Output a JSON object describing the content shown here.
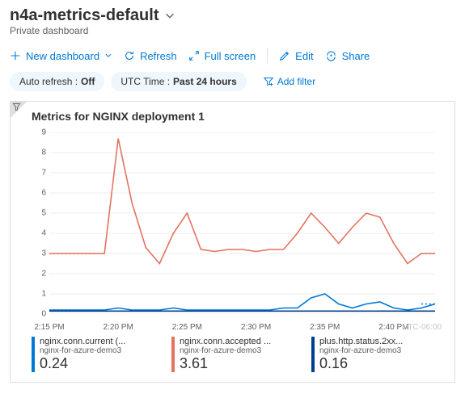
{
  "header": {
    "title": "n4a-metrics-default",
    "subtitle": "Private dashboard"
  },
  "toolbar": {
    "new_dashboard": "New dashboard",
    "refresh": "Refresh",
    "fullscreen": "Full screen",
    "edit": "Edit",
    "share": "Share"
  },
  "filters": {
    "auto_refresh_label": "Auto refresh :",
    "auto_refresh_value": "Off",
    "utc_label": "UTC Time :",
    "utc_value": "Past 24 hours",
    "add_filter": "Add filter"
  },
  "card": {
    "title": "Metrics for NGINX deployment 1",
    "tz": "UTC-06:00"
  },
  "chart_data": {
    "type": "line",
    "ylim": [
      0,
      9
    ],
    "yticks": [
      0,
      1,
      2,
      3,
      4,
      5,
      6,
      7,
      8,
      9
    ],
    "x": [
      "2:15 PM",
      "2:16",
      "2:17",
      "2:18",
      "2:19",
      "2:20 PM",
      "2:21",
      "2:22",
      "2:23",
      "2:24",
      "2:25 PM",
      "2:26",
      "2:27",
      "2:28",
      "2:29",
      "2:30 PM",
      "2:31",
      "2:32",
      "2:33",
      "2:34",
      "2:35 PM",
      "2:36",
      "2:37",
      "2:38",
      "2:39",
      "2:40 PM",
      "2:41",
      "2:42",
      "2:43"
    ],
    "x_tick_labels": [
      "2:15 PM",
      "2:20 PM",
      "2:25 PM",
      "2:30 PM",
      "2:35 PM",
      "2:40 PM"
    ],
    "x_tick_idx": [
      0,
      5,
      10,
      15,
      20,
      25
    ],
    "series": [
      {
        "name": "nginx.conn.current (...",
        "resource": "nginx-for-azure-demo3",
        "agg_value": "0.24",
        "color": "#0078d4",
        "values": [
          0.2,
          0.2,
          0.2,
          0.2,
          0.2,
          0.3,
          0.2,
          0.2,
          0.2,
          0.3,
          0.2,
          0.2,
          0.2,
          0.2,
          0.2,
          0.2,
          0.2,
          0.3,
          0.3,
          0.8,
          1.0,
          0.5,
          0.3,
          0.5,
          0.6,
          0.3,
          0.2,
          0.3,
          0.5
        ]
      },
      {
        "name": "nginx.conn.accepted ...",
        "resource": "nginx-for-azure-demo3",
        "agg_value": "3.61",
        "color": "#e3735e",
        "values": [
          3.0,
          3.0,
          3.0,
          3.0,
          3.0,
          8.7,
          5.5,
          3.3,
          2.5,
          4.0,
          5.0,
          3.2,
          3.1,
          3.2,
          3.2,
          3.1,
          3.2,
          3.2,
          4.0,
          5.0,
          4.3,
          3.5,
          4.3,
          5.0,
          4.8,
          3.5,
          2.5,
          3.0,
          3.0
        ]
      },
      {
        "name": "plus.http.status.2xx...",
        "resource": "nginx-for-azure-demo3",
        "agg_value": "0.16",
        "color": "#003f8c",
        "values": [
          0.15,
          0.15,
          0.15,
          0.15,
          0.15,
          0.15,
          0.15,
          0.15,
          0.15,
          0.15,
          0.15,
          0.15,
          0.15,
          0.15,
          0.15,
          0.15,
          0.15,
          0.15,
          0.15,
          0.15,
          0.15,
          0.15,
          0.15,
          0.15,
          0.15,
          0.15,
          0.15,
          0.15,
          0.15
        ]
      }
    ]
  }
}
